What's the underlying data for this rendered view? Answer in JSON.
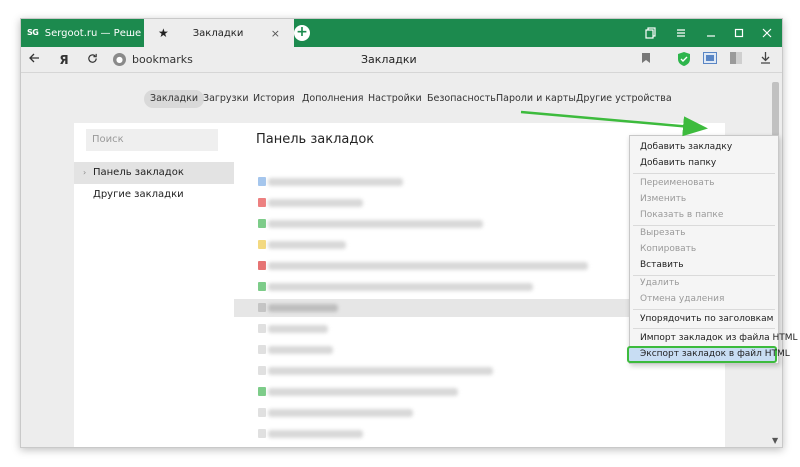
{
  "tabs": [
    {
      "favicon": "SG",
      "title": "Sergoot.ru — Решение ва"
    },
    {
      "icon": "star-icon",
      "title": "Закладки",
      "close": "×"
    }
  ],
  "new_tab": "+",
  "address": {
    "url": "bookmarks",
    "page_title": "Закладки"
  },
  "settings_menu": [
    "Закладки",
    "Загрузки",
    "История",
    "Дополнения",
    "Настройки",
    "Безопасность",
    "Пароли и карты",
    "Другие устройства"
  ],
  "sidebar": {
    "search_placeholder": "Поиск",
    "items": [
      "Панель закладок",
      "Другие закладки"
    ]
  },
  "main": {
    "title": "Панель закладок"
  },
  "context_menu": {
    "items": [
      "Добавить закладку",
      "Добавить папку",
      "Переименовать",
      "Изменить",
      "Показать в папке",
      "Вырезать",
      "Копировать",
      "Вставить",
      "Удалить",
      "Отмена удаления",
      "Упорядочить по заголовкам",
      "Импорт закладок из файла HTML",
      "Экспорт закладок в файл HTML"
    ]
  },
  "colors": {
    "titlebar": "#1c8a4e",
    "highlight_border": "#3dbb3d",
    "arrow": "#3dbb3d"
  }
}
